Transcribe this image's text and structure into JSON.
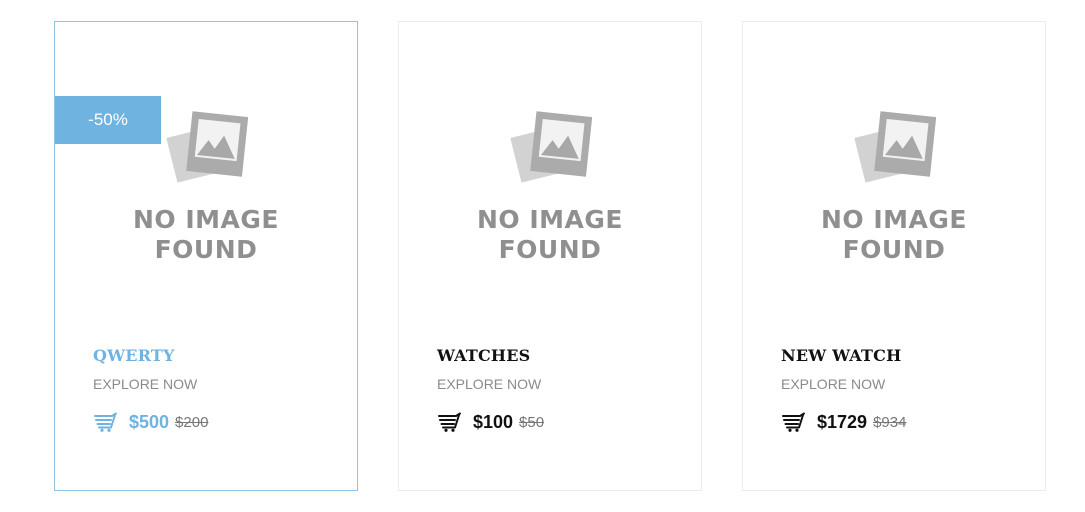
{
  "colors": {
    "accent": "#6fb3e0",
    "active_border": "#8cc6e4",
    "card_border": "#ececec",
    "placeholder_gray": "#8f8f8f",
    "text_dark": "#111111",
    "muted": "#8a8a8a"
  },
  "products": [
    {
      "badge": "-50%",
      "placeholder_line1": "NO IMAGE",
      "placeholder_line2": "FOUND",
      "title": "QWERTY",
      "explore": "EXPLORE NOW",
      "price": "$500",
      "old_price": "$200",
      "cart_icon": "cart-icon"
    },
    {
      "placeholder_line1": "NO IMAGE",
      "placeholder_line2": "FOUND",
      "title": "WATCHES",
      "explore": "EXPLORE NOW",
      "price": "$100",
      "old_price": "$50",
      "cart_icon": "cart-icon"
    },
    {
      "placeholder_line1": "NO IMAGE",
      "placeholder_line2": "FOUND",
      "title": "NEW WATCH",
      "explore": "EXPLORE NOW",
      "price": "$1729",
      "old_price": "$934",
      "cart_icon": "cart-icon"
    }
  ]
}
